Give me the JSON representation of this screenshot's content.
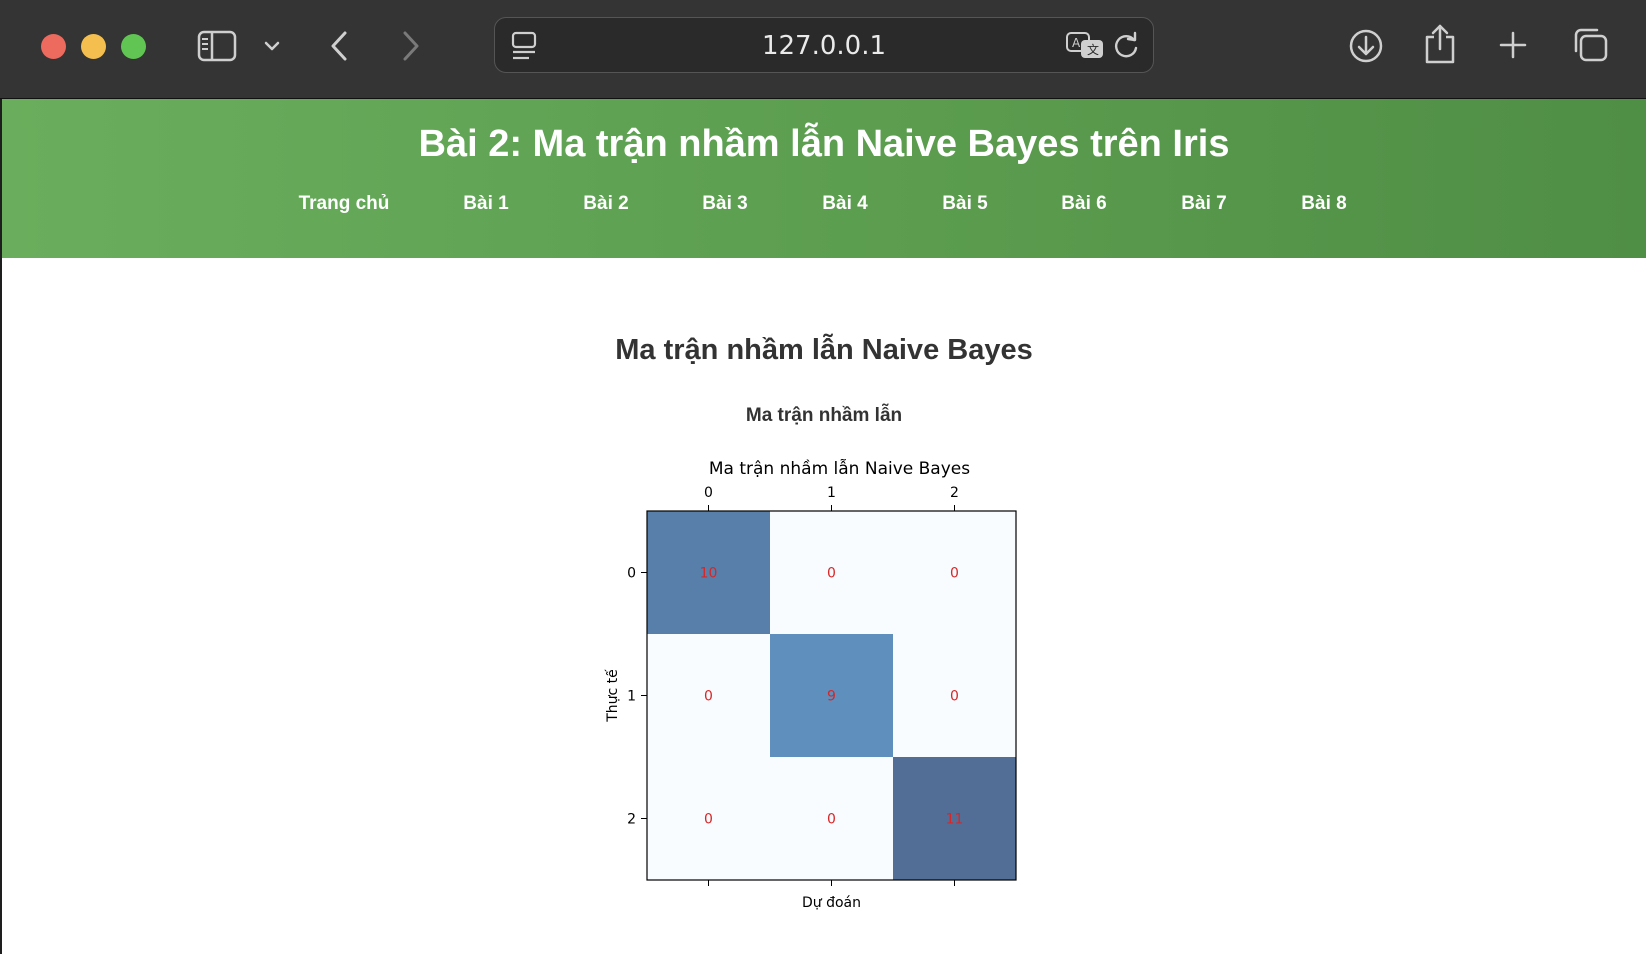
{
  "browser": {
    "url": "127.0.0.1"
  },
  "header": {
    "title": "Bài 2: Ma trận nhầm lẫn Naive Bayes trên Iris",
    "nav": [
      "Trang chủ",
      "Bài 1",
      "Bài 2",
      "Bài 3",
      "Bài 4",
      "Bài 5",
      "Bài 6",
      "Bài 7",
      "Bài 8"
    ]
  },
  "main": {
    "heading": "Ma trận nhầm lẫn Naive Bayes",
    "subheading": "Ma trận nhầm lẫn"
  },
  "chart_data": {
    "type": "heatmap",
    "title": "Ma trận nhầm lẫn Naive Bayes",
    "xlabel": "Dự đoán",
    "ylabel": "Thực tế",
    "x_ticks": [
      "0",
      "1",
      "2"
    ],
    "y_ticks": [
      "0",
      "1",
      "2"
    ],
    "matrix": [
      [
        10,
        0,
        0
      ],
      [
        0,
        9,
        0
      ],
      [
        0,
        0,
        11
      ]
    ],
    "colormap": "Blues",
    "cell_text_color": "#d62728",
    "grid": false
  },
  "colors": {
    "header_start": "#6aae5d",
    "header_end": "#4f8e45",
    "heading_text": "#333333"
  }
}
